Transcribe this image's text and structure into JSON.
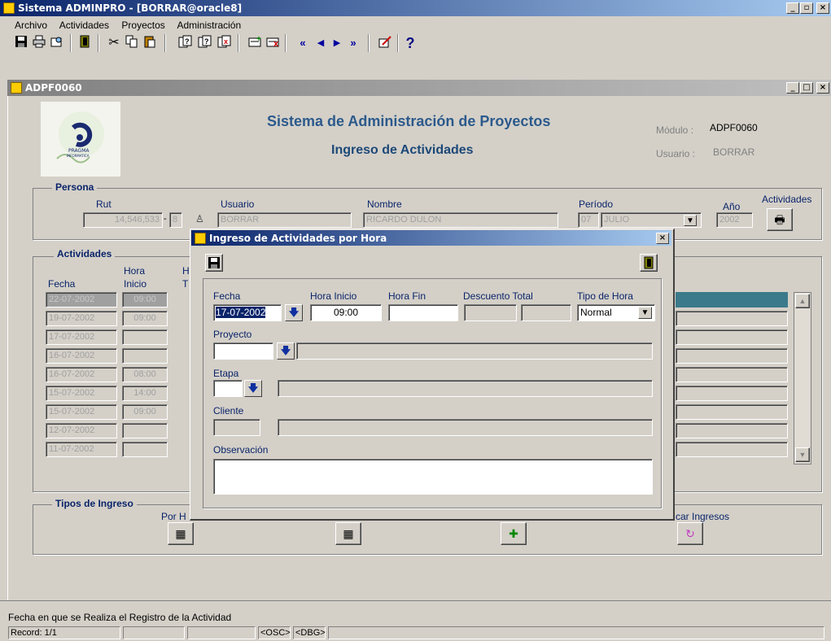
{
  "app": {
    "title": "Sistema ADMINPRO - [BORRAR@oracle8]",
    "menu": [
      "Archivo",
      "Actividades",
      "Proyectos",
      "Administración"
    ],
    "menu_underline": [
      "A",
      "A",
      "P",
      "A"
    ],
    "toolbar_icons": [
      "save-icon",
      "print-icon",
      "print-preview-icon",
      "exit-icon",
      "cut-icon",
      "copy-icon",
      "paste-icon",
      "query-icon",
      "query-enter-icon",
      "query-cancel-icon",
      "insert-record-icon",
      "delete-record-icon",
      "first-record-icon",
      "previous-record-icon",
      "next-record-icon",
      "last-record-icon",
      "edit-icon",
      "help-icon"
    ]
  },
  "child": {
    "title": "ADPF0060",
    "header": {
      "title1": "Sistema de Administración de Proyectos",
      "title2": "Ingreso de Actividades",
      "modulo_label": "Módulo :",
      "modulo_value": "ADPF0060",
      "usuario_label": "Usuario :",
      "usuario_value": "BORRAR",
      "logo_text": "PRAGMA",
      "logo_sub": "INFORMATICA"
    },
    "persona": {
      "legend": "Persona",
      "rut_label": "Rut",
      "rut_value": "14,546,533",
      "rut_dv": "8",
      "usuario_label": "Usuario",
      "usuario_value": "BORRAR",
      "nombre_label": "Nombre",
      "nombre_value": "RICARDO DULON",
      "periodo_label": "Período",
      "periodo_num": "07",
      "periodo_mes": "JULIO",
      "anio_label": "Año",
      "anio_value": "2002",
      "actividades_label": "Actividades"
    },
    "actividades": {
      "legend": "Actividades",
      "col_fecha": "Fecha",
      "col_hora_inicio_1": "Hora",
      "col_hora_inicio_2": "Inicio",
      "col_hora_fin_1": "H",
      "col_hora_fin_2": "T",
      "rows": [
        {
          "fecha": "22-07-2002",
          "hora": "09:00"
        },
        {
          "fecha": "19-07-2002",
          "hora": "09:00"
        },
        {
          "fecha": "17-07-2002",
          "hora": ""
        },
        {
          "fecha": "16-07-2002",
          "hora": ""
        },
        {
          "fecha": "16-07-2002",
          "hora": "08:00"
        },
        {
          "fecha": "15-07-2002",
          "hora": "14:00"
        },
        {
          "fecha": "15-07-2002",
          "hora": "09:00"
        },
        {
          "fecha": "12-07-2002",
          "hora": ""
        },
        {
          "fecha": "11-07-2002",
          "hora": ""
        }
      ]
    },
    "tipos": {
      "legend": "Tipos de Ingreso",
      "por_hora": "Por H",
      "buscar": "car Ingresos"
    }
  },
  "dialog": {
    "title": "Ingreso de Actividades por Hora",
    "fecha_label": "Fecha",
    "fecha_value": "17-07-2002",
    "hora_inicio_label": "Hora Inicio",
    "hora_inicio_value": "09:00",
    "hora_fin_label": "Hora Fin",
    "descuento_label": "Descuento Total",
    "tipo_hora_label": "Tipo de Hora",
    "tipo_hora_value": "Normal",
    "proyecto_label": "Proyecto",
    "etapa_label": "Etapa",
    "cliente_label": "Cliente",
    "observacion_label": "Observación"
  },
  "status": {
    "hint": "Fecha en que se Realiza el Registro de la Actividad",
    "record": "Record: 1/1",
    "osc": "<OSC>",
    "dbg": "<DBG>"
  },
  "colors": {
    "title_bar": "#0a246a",
    "selected_row": "#3a7a8a",
    "header_title": "#2c5a8c"
  }
}
